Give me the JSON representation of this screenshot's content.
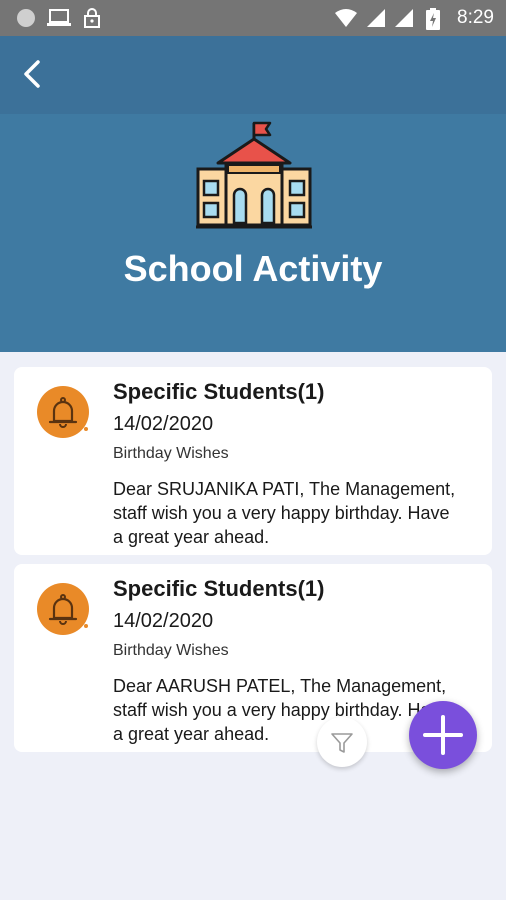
{
  "status_bar": {
    "time": "8:29",
    "icons": [
      "notification-dot-icon",
      "laptop-icon",
      "lock-icon",
      "wifi-icon",
      "signal-icon",
      "signal-icon",
      "battery-charging-icon"
    ]
  },
  "header": {
    "back_icon": "chevron-left-icon"
  },
  "hero": {
    "icon": "school-building-icon",
    "title": "School Activity"
  },
  "activities": [
    {
      "icon": "bell-icon",
      "title": "Specific Students(1)",
      "date": "14/02/2020",
      "category": "Birthday Wishes",
      "message": "Dear SRUJANIKA PATI, The Management, staff wish you a very happy birthday. Have a great year ahead."
    },
    {
      "icon": "bell-icon",
      "title": "Specific Students(1)",
      "date": "14/02/2020",
      "category": "Birthday Wishes",
      "message": "Dear AARUSH PATEL, The Management, staff wish you a very happy birthday. Have a great year ahead."
    }
  ],
  "actions": {
    "filter_icon": "filter-icon",
    "add_icon": "plus-icon"
  },
  "colors": {
    "header": "#3c7199",
    "hero": "#3f7aa2",
    "background": "#eef0f8",
    "bell": "#e98a28",
    "fab": "#7a4fdc"
  }
}
